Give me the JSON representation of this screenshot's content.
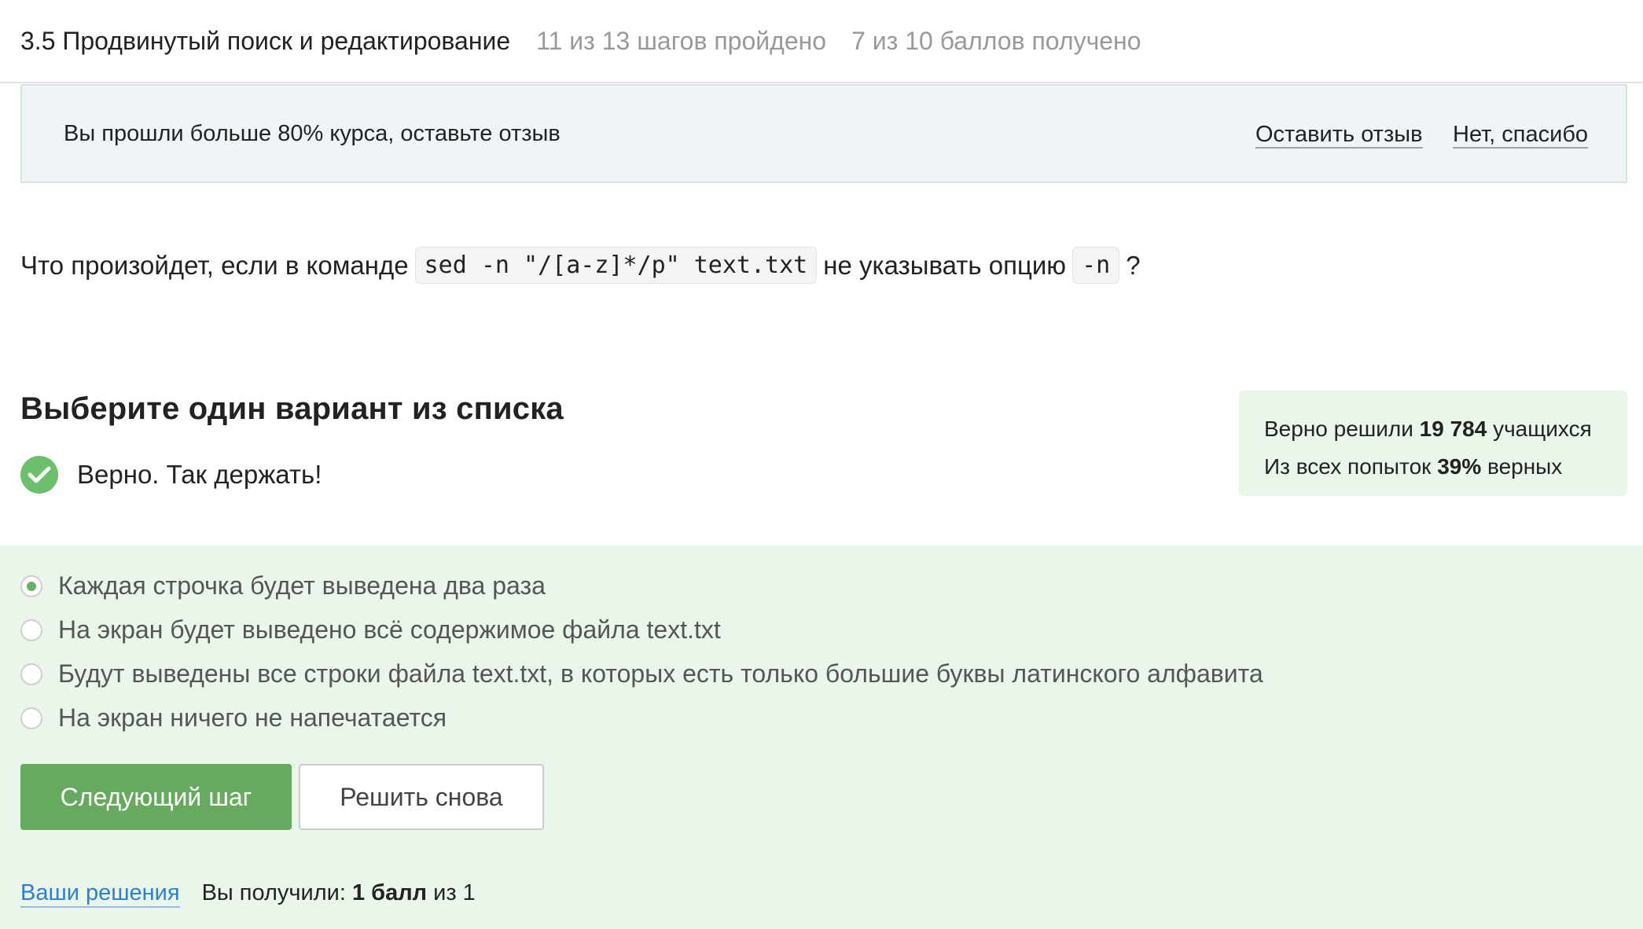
{
  "header": {
    "lesson_title": "3.5 Продвинутый поиск и редактирование",
    "steps_progress": "11 из 13 шагов пройдено",
    "points_progress": "7 из 10 баллов  получено"
  },
  "feedback_banner": {
    "text": "Вы прошли больше 80% курса, оставьте отзыв",
    "leave_review_label": "Оставить отзыв",
    "decline_label": "Нет, спасибо"
  },
  "question": {
    "prefix": "Что произойдет, если в команде",
    "command": "sed -n \"/[a-z]*/p\" text.txt",
    "middle": "не указывать опцию",
    "option_code": "-n",
    "suffix": "?"
  },
  "quiz": {
    "instruction": "Выберите один вариант из списка",
    "result_text": "Верно. Так держать!",
    "icon": "check-circle-icon",
    "options": [
      {
        "label": "Каждая строчка будет выведена два раза",
        "selected": true
      },
      {
        "label": "На экран будет выведено всё содержимое файла text.txt",
        "selected": false
      },
      {
        "label": "Будут выведены все строки файла text.txt, в которых есть только большие буквы латинского алфавита",
        "selected": false
      },
      {
        "label": "На экран ничего не напечатается",
        "selected": false
      }
    ],
    "next_button": "Следующий шаг",
    "retry_button": "Решить снова"
  },
  "stats": {
    "solved_prefix": "Верно решили",
    "solved_count": "19 784",
    "solved_suffix": "учащихся",
    "attempts_prefix": "Из всех попыток",
    "attempts_percent": "39%",
    "attempts_suffix": "верных"
  },
  "footer": {
    "solutions_link": "Ваши решения",
    "score_prefix": "Вы получили:",
    "score_value": "1 балл",
    "score_suffix": "из 1"
  },
  "colors": {
    "accent_green": "#66aa5e",
    "success_bg": "#eaf6ea",
    "link_blue": "#2e7fd1",
    "banner_bg": "#eff4f7"
  }
}
